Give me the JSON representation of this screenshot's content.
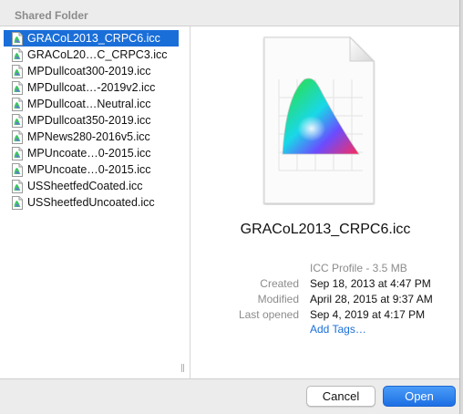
{
  "header": {
    "title": "Shared Folder"
  },
  "files": [
    {
      "name": "GRACoL2013_CRPC6.icc",
      "selected": true
    },
    {
      "name": "GRACoL20…C_CRPC3.icc",
      "selected": false
    },
    {
      "name": "MPDullcoat300-2019.icc",
      "selected": false
    },
    {
      "name": "MPDullcoat…-2019v2.icc",
      "selected": false
    },
    {
      "name": "MPDullcoat…Neutral.icc",
      "selected": false
    },
    {
      "name": "MPDullcoat350-2019.icc",
      "selected": false
    },
    {
      "name": "MPNews280-2016v5.icc",
      "selected": false
    },
    {
      "name": "MPUncoate…0-2015.icc",
      "selected": false
    },
    {
      "name": "MPUncoate…0-2015.icc",
      "selected": false
    },
    {
      "name": "USSheetfedCoated.icc",
      "selected": false
    },
    {
      "name": "USSheetfedUncoated.icc",
      "selected": false
    }
  ],
  "preview": {
    "filename": "GRACoL2013_CRPC6.icc",
    "kind": "ICC Profile - 3.5 MB",
    "created_label": "Created",
    "created_value": "Sep 18, 2013 at 4:47 PM",
    "modified_label": "Modified",
    "modified_value": "April 28, 2015 at 9:37 AM",
    "opened_label": "Last opened",
    "opened_value": "Sep 4, 2019 at 4:17 PM",
    "add_tags": "Add Tags…"
  },
  "column_resize_glyph": "||",
  "buttons": {
    "cancel": "Cancel",
    "open": "Open"
  },
  "colors": {
    "selection": "#1a6ed8",
    "accent": "#1a6ed8"
  },
  "icons": [
    "icc-file-icon",
    "color-gamut-document-icon",
    "column-resize-icon"
  ]
}
